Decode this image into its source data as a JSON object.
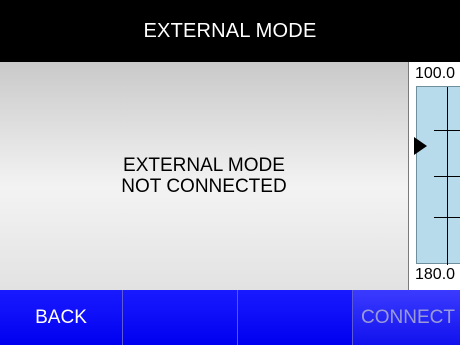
{
  "title_bar": {
    "title": "EXTERNAL MODE"
  },
  "status_panel": {
    "line1": "EXTERNAL MODE",
    "line2": "NOT CONNECTED"
  },
  "gauge": {
    "max_label": "100.0",
    "min_label": "180.0",
    "pointer_icon": "triangle-right-icon"
  },
  "buttons": {
    "back_label": "BACK",
    "softkey2_label": "",
    "softkey3_label": "",
    "connect_label": "CONNECT"
  },
  "colors": {
    "title_bar_bg": "#000000",
    "button_bar_bg": "#0000ff",
    "gauge_scale_bg": "#b7dbea",
    "connect_text_disabled": "#9a9ad8"
  }
}
